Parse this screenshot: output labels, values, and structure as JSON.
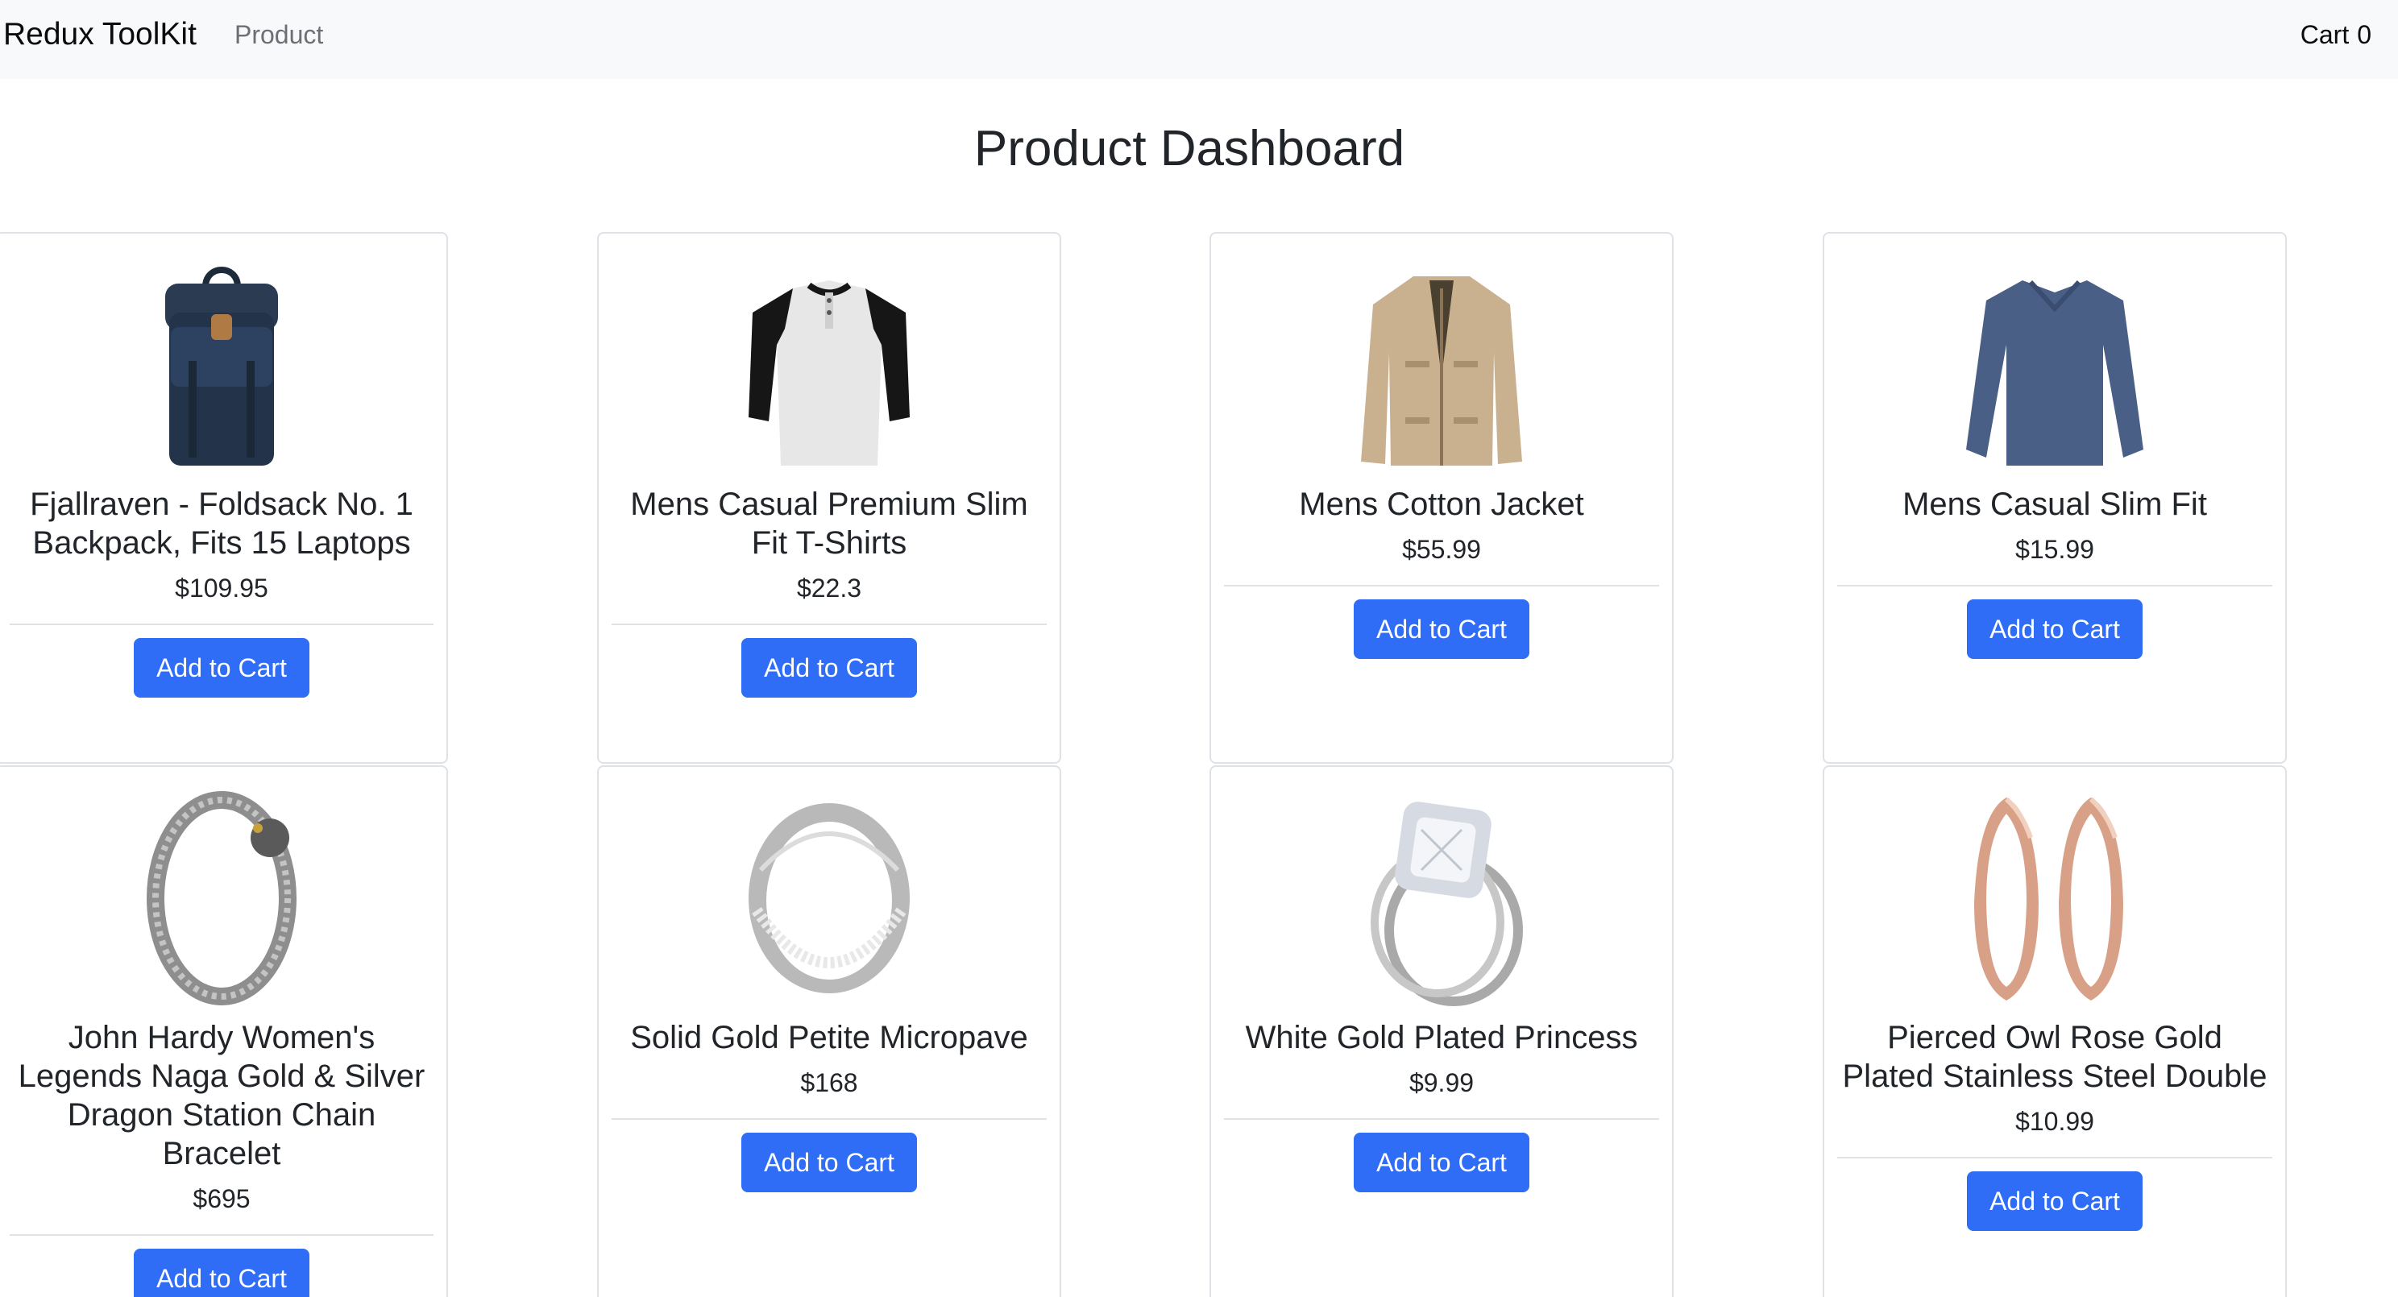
{
  "navbar": {
    "brand": "Redux ToolKit",
    "product_link": "Product",
    "cart_label": "Cart",
    "cart_count": "0"
  },
  "page": {
    "title": "Product Dashboard"
  },
  "products": [
    {
      "title": "Fjallraven - Foldsack No. 1 Backpack, Fits 15 Laptops",
      "price": "$109.95",
      "button": "Add to Cart",
      "icon": "backpack-image"
    },
    {
      "title": "Mens Casual Premium Slim Fit T-Shirts",
      "price": "$22.3",
      "button": "Add to Cart",
      "icon": "tshirt-image"
    },
    {
      "title": "Mens Cotton Jacket",
      "price": "$55.99",
      "button": "Add to Cart",
      "icon": "jacket-image"
    },
    {
      "title": "Mens Casual Slim Fit",
      "price": "$15.99",
      "button": "Add to Cart",
      "icon": "longsleeve-image"
    },
    {
      "title": "John Hardy Women's Legends Naga Gold & Silver Dragon Station Chain Bracelet",
      "price": "$695",
      "button": "Add to Cart",
      "icon": "bracelet-image"
    },
    {
      "title": "Solid Gold Petite Micropave",
      "price": "$168",
      "button": "Add to Cart",
      "icon": "ring-image"
    },
    {
      "title": "White Gold Plated Princess",
      "price": "$9.99",
      "button": "Add to Cart",
      "icon": "diamond-ring-image"
    },
    {
      "title": "Pierced Owl Rose Gold Plated Stainless Steel Double",
      "price": "$10.99",
      "button": "Add to Cart",
      "icon": "earrings-image"
    }
  ]
}
